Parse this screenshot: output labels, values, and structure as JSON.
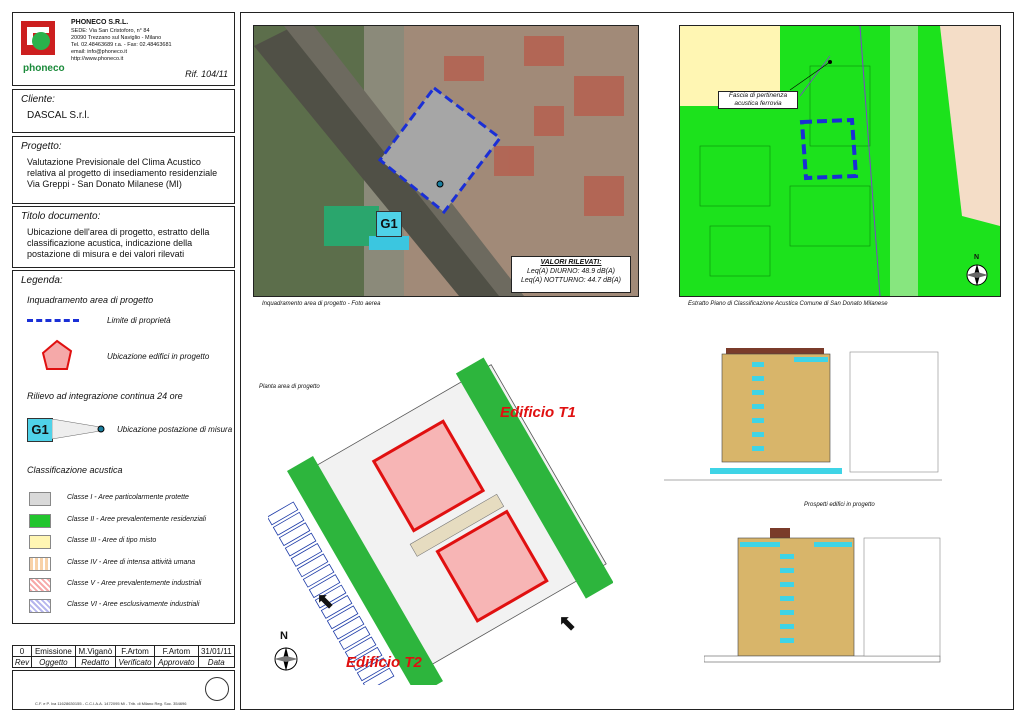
{
  "company": {
    "name": "PHONECO S.R.L.",
    "address_lines": [
      "SEDE: Via San Cristoforo, n° 84",
      "20090 Trezzano sul Naviglio - Milano",
      "Tel. 02.48463689 r.a. - Fax: 02.48463681",
      "email: info@phoneco.it",
      "http://www.phoneco.it"
    ],
    "logo_text": "phoneco",
    "ref": "Rif. 104/11"
  },
  "cliente": {
    "label": "Cliente:",
    "value": "DASCAL S.r.l."
  },
  "progetto": {
    "label": "Progetto:",
    "lines": [
      "Valutazione Previsionale del Clima Acustico",
      "relativa al progetto di insediamento residenziale",
      "Via Greppi - San Donato Milanese (MI)"
    ]
  },
  "titolo": {
    "label": "Titolo documento:",
    "lines": [
      "Ubicazione dell'area di progetto, estratto della",
      "classificazione acustica, indicazione della",
      "postazione di misura e dei valori rilevati"
    ]
  },
  "legenda": {
    "label": "Legenda:",
    "section1": "Inquadramento area di progetto",
    "limite": "Limite di proprietà",
    "edifici": "Ubicazione edifici in progetto",
    "section2": "Rilievo ad integrazione continua 24 ore",
    "g1": "G1",
    "postazione": "Ubicazione postazione di misura",
    "section3": "Classificazione acustica",
    "classes": [
      {
        "label": "Classe I - Aree particolarmente protette",
        "color": "#d9d9d9"
      },
      {
        "label": "Classe II - Aree prevalentemente residenziali",
        "color": "#22c52e"
      },
      {
        "label": "Classe III - Aree di tipo misto",
        "color": "#fff6b3"
      },
      {
        "label": "Classe IV - Aree di intensa attività umana",
        "color": "#f8d2a8"
      },
      {
        "label": "Classe V - Aree prevalentemente industriali",
        "color": "#f7a9a9"
      },
      {
        "label": "Classe VI - Aree esclusivamente industriali",
        "color": "#b6b6ee"
      }
    ]
  },
  "revisions": {
    "row": [
      "0",
      "Emissione",
      "M.Viganò",
      "F.Artom",
      "F.Artom",
      "31/01/11"
    ],
    "headers": [
      "Rev",
      "Oggetto",
      "Redatto",
      "Verificato",
      "Approvato",
      "Data"
    ]
  },
  "footer_text": "C.F. e P. Iva 11628630155 - C.C.I.A.A. 1472095 Mi - Trib. di Milano Reg. Soc. 354696",
  "aerial": {
    "caption": "Inquadramento area di progetto - Foto aerea",
    "g1": "G1",
    "valori_title": "VALORI RILEVATI:",
    "diurno": "Leq(A) DIURNO: 48.9 dB(A)",
    "notturno": "Leq(A) NOTTURNO: 44.7 dB(A)"
  },
  "map": {
    "caption": "Estratto Piano di Classificazione Acustica Comune di San Donato Milanese",
    "fascia_line1": "Fascia di pertinenza",
    "fascia_line2": "acustica ferrovia",
    "north": "N"
  },
  "plan": {
    "caption": "Planta area di progetto",
    "t1": "Edificio T1",
    "t2": "Edificio T2",
    "north": "N"
  },
  "elevations": {
    "caption": "Prospetti edifici in progetto"
  }
}
